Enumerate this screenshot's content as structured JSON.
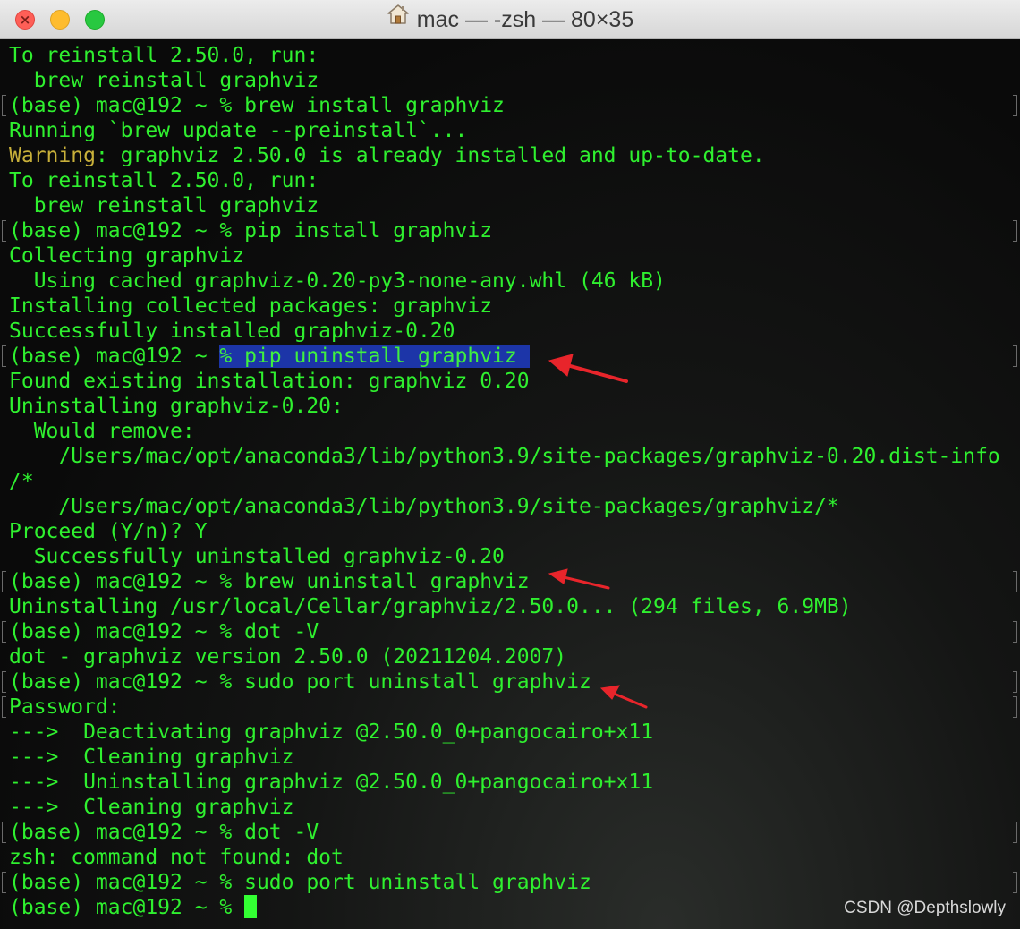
{
  "window": {
    "title": "mac — -zsh — 80×35",
    "icon": "home-folder-icon",
    "controls": [
      "close-button",
      "minimize-button",
      "maximize-button"
    ]
  },
  "terminal": {
    "lines": [
      {
        "text": "To reinstall 2.50.0, run:"
      },
      {
        "text": "  brew reinstall graphviz"
      },
      {
        "text": "(base) mac@192 ~ % brew install graphviz",
        "prompt": true
      },
      {
        "text": "Running `brew update --preinstall`..."
      },
      {
        "warn": "Warning",
        "text": ": graphviz 2.50.0 is already installed and up-to-date."
      },
      {
        "text": "To reinstall 2.50.0, run:"
      },
      {
        "text": "  brew reinstall graphviz"
      },
      {
        "text": "(base) mac@192 ~ % pip install graphviz",
        "prompt": true
      },
      {
        "text": "Collecting graphviz"
      },
      {
        "text": "  Using cached graphviz-0.20-py3-none-any.whl (46 kB)"
      },
      {
        "text": "Installing collected packages: graphviz"
      },
      {
        "text": "Successfully installed graphviz-0.20"
      },
      {
        "pre": "(base) mac@192 ~ ",
        "selected": "% pip uninstall graphviz ",
        "prompt": true
      },
      {
        "text": "Found existing installation: graphviz 0.20"
      },
      {
        "text": "Uninstalling graphviz-0.20:"
      },
      {
        "text": "  Would remove:"
      },
      {
        "text": "    /Users/mac/opt/anaconda3/lib/python3.9/site-packages/graphviz-0.20.dist-info"
      },
      {
        "text": "/*"
      },
      {
        "text": "    /Users/mac/opt/anaconda3/lib/python3.9/site-packages/graphviz/*"
      },
      {
        "text": "Proceed (Y/n)? Y"
      },
      {
        "text": "  Successfully uninstalled graphviz-0.20"
      },
      {
        "text": "(base) mac@192 ~ % brew uninstall graphviz",
        "prompt": true
      },
      {
        "text": "Uninstalling /usr/local/Cellar/graphviz/2.50.0... (294 files, 6.9MB)"
      },
      {
        "text": "(base) mac@192 ~ % dot -V",
        "prompt": true
      },
      {
        "text": "dot - graphviz version 2.50.0 (20211204.2007)"
      },
      {
        "text": "(base) mac@192 ~ % sudo port uninstall graphviz",
        "prompt": true
      },
      {
        "text": "Password:",
        "prompt": true
      },
      {
        "text": "--->  Deactivating graphviz @2.50.0_0+pangocairo+x11"
      },
      {
        "text": "--->  Cleaning graphviz"
      },
      {
        "text": "--->  Uninstalling graphviz @2.50.0_0+pangocairo+x11"
      },
      {
        "text": "--->  Cleaning graphviz"
      },
      {
        "text": "(base) mac@192 ~ % dot -V",
        "prompt": true
      },
      {
        "text": "zsh: command not found: dot"
      },
      {
        "text": "(base) mac@192 ~ % sudo port uninstall graphviz",
        "prompt": true
      },
      {
        "text": "(base) mac@192 ~ % ",
        "cursor": true
      }
    ]
  },
  "colors": {
    "foreground": "#2ff02f",
    "warning": "#c8b03a",
    "selection": "#1c35a8",
    "arrow": "#e8252b"
  },
  "watermark": "CSDN @Depthslowly"
}
